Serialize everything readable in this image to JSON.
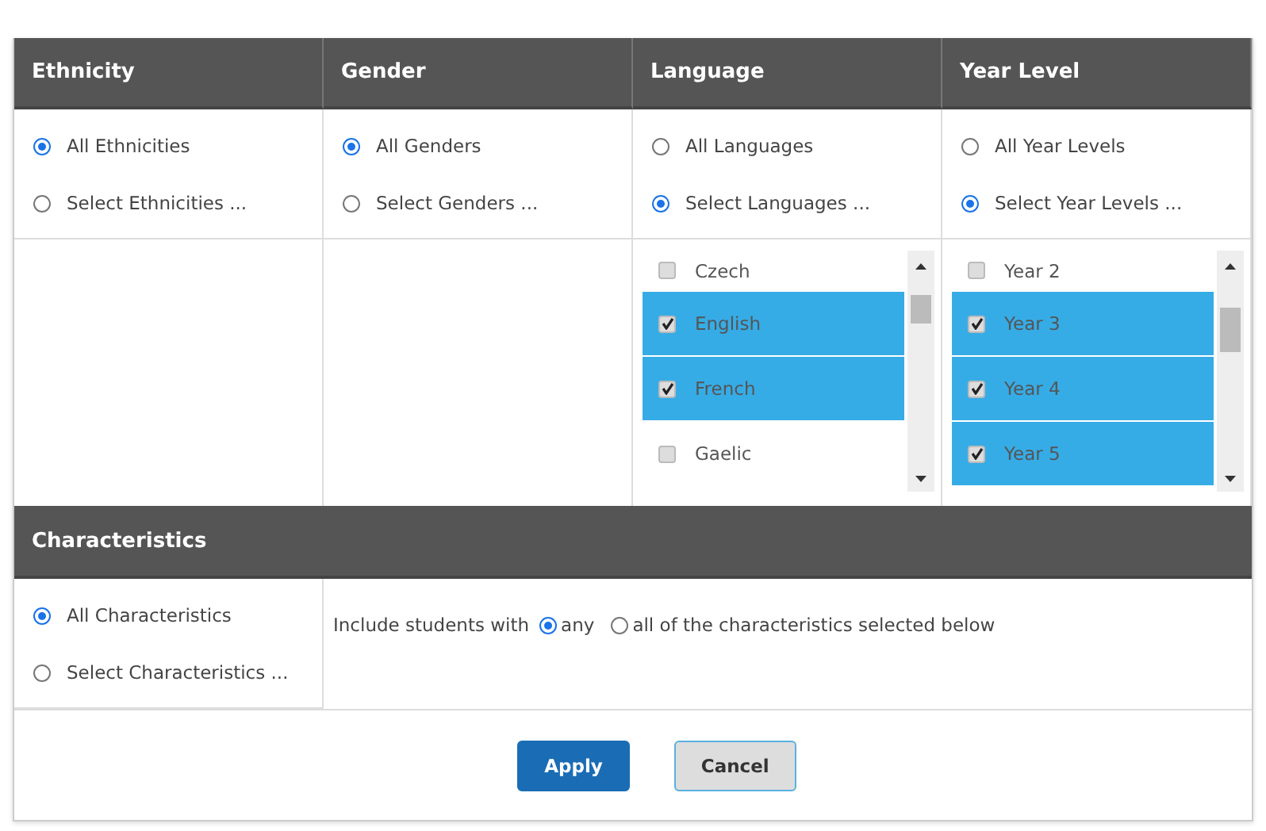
{
  "filters": [
    {
      "title": "Ethnicity",
      "options": [
        {
          "label": "All Ethnicities",
          "selected": true
        },
        {
          "label": "Select Ethnicities ...",
          "selected": false
        }
      ]
    },
    {
      "title": "Gender",
      "options": [
        {
          "label": "All Genders",
          "selected": true
        },
        {
          "label": "Select Genders ...",
          "selected": false
        }
      ]
    },
    {
      "title": "Language",
      "options": [
        {
          "label": "All Languages",
          "selected": false
        },
        {
          "label": "Select Languages ...",
          "selected": true
        }
      ],
      "items": [
        {
          "label": "Czech",
          "checked": false
        },
        {
          "label": "English",
          "checked": true
        },
        {
          "label": "French",
          "checked": true
        },
        {
          "label": "Gaelic",
          "checked": false
        }
      ]
    },
    {
      "title": "Year Level",
      "options": [
        {
          "label": "All Year Levels",
          "selected": false
        },
        {
          "label": "Select Year Levels ...",
          "selected": true
        }
      ],
      "items": [
        {
          "label": "Year 2",
          "checked": false
        },
        {
          "label": "Year 3",
          "checked": true
        },
        {
          "label": "Year 4",
          "checked": true
        },
        {
          "label": "Year 5",
          "checked": true
        }
      ]
    }
  ],
  "characteristics": {
    "title": "Characteristics",
    "options": [
      {
        "label": "All Characteristics",
        "selected": true
      },
      {
        "label": "Select Characteristics ...",
        "selected": false
      }
    ],
    "include_label": "Include students with",
    "match": [
      {
        "label": "any",
        "selected": true
      },
      {
        "label": "all of the characteristics selected below",
        "selected": false
      }
    ]
  },
  "buttons": [
    {
      "label": "Apply",
      "kind": "primary"
    },
    {
      "label": "Cancel",
      "kind": "secondary"
    }
  ]
}
